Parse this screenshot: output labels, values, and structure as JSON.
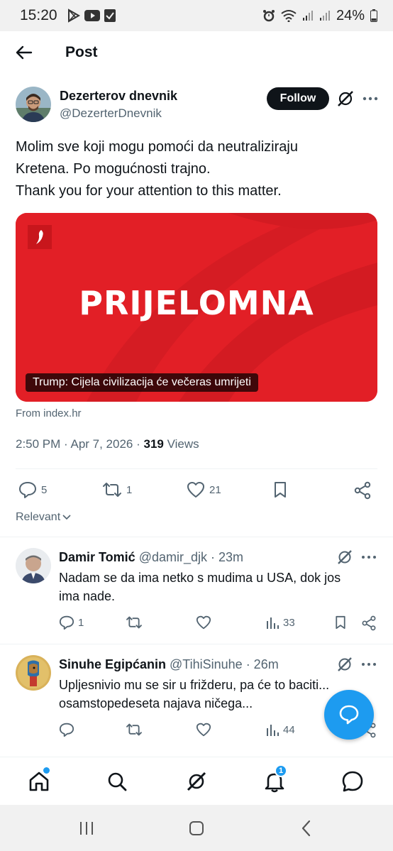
{
  "status_bar": {
    "time": "15:20",
    "battery": "24%",
    "icons": [
      "play-store-icon",
      "youtube-icon",
      "check-box-icon",
      "alarm-icon",
      "wifi-icon",
      "signal-icon",
      "signal-icon-2",
      "battery-icon"
    ]
  },
  "header": {
    "title": "Post"
  },
  "post": {
    "author_name": "Dezerterov dnevnik",
    "author_handle": "@DezerterDnevnik",
    "follow_label": "Follow",
    "text_lines": [
      "Molim sve koji mogu pomoći da neutraliziraju",
      "Kretena. Po mogućnosti trajno.",
      "Thank you for your attention to this matter."
    ],
    "card": {
      "headline": "PRIJELOMNA",
      "caption": "Trump: Cijela civilizacija će večeras umrijeti",
      "source": "From index.hr",
      "accent": "#e21f26"
    },
    "timestamp": "2:50 PM · Apr 7, 2026 · ",
    "views_count": "319",
    "views_label": " Views",
    "replies": "5",
    "reposts": "1",
    "likes": "21"
  },
  "sort_label": "Relevant",
  "replies": [
    {
      "name": "Damir Tomić",
      "handle": "@damir_djk · 23m",
      "text": "Nadam se da ima netko s mudima u USA, dok jos ima nade.",
      "replies": "1",
      "reposts": "",
      "likes": "",
      "views": "33"
    },
    {
      "name": "Sinuhe Egipćanin",
      "handle": "@TihiSinuhe · 26m",
      "text": "Upljesnivio mu se sir u frižderu, pa će to baciti... osamstopedeseta najava ničega...",
      "replies": "",
      "reposts": "",
      "likes": "",
      "views": "44"
    }
  ],
  "bottom_nav": {
    "notifications_badge": "1"
  },
  "colors": {
    "brand_blue": "#1d9bf0",
    "text": "#0f1419",
    "muted": "#536471"
  }
}
